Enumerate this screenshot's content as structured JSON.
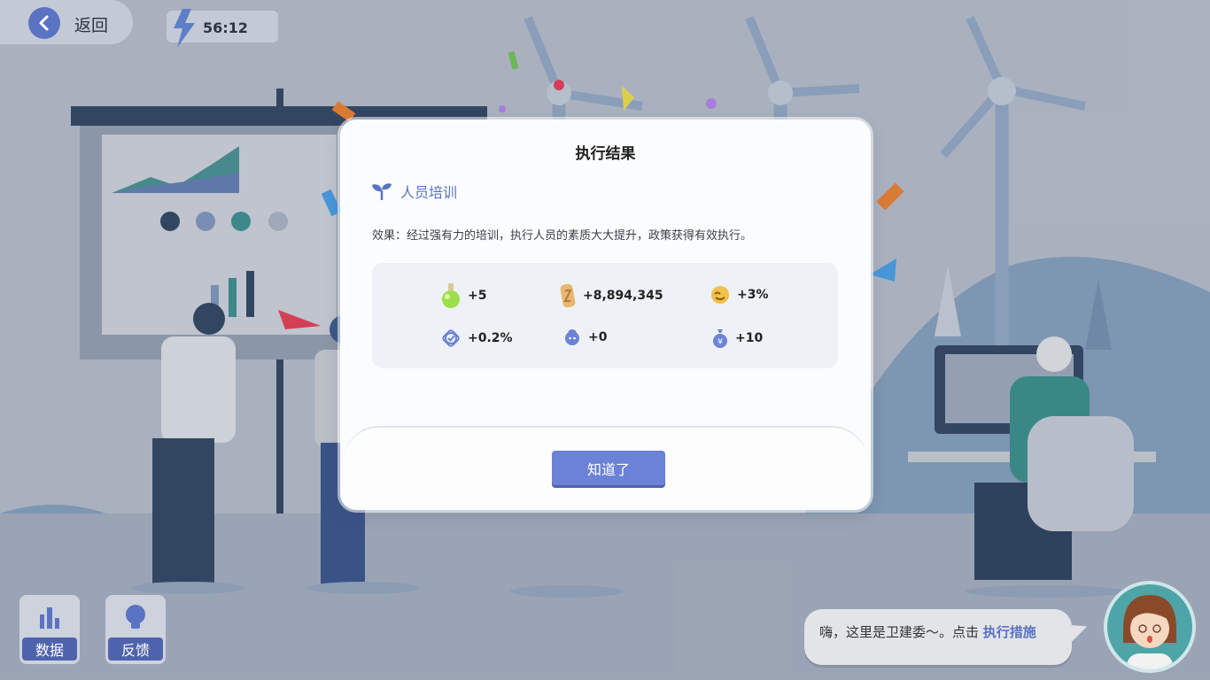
{
  "header": {
    "back_label": "返回",
    "timer": "56:12"
  },
  "result_dialog": {
    "title": "执行结果",
    "measure_name": "人员培训",
    "effect_text": "效果：经过强有力的培训，执行人员的素质大大提升，政策获得有效执行。",
    "stats": [
      {
        "icon": "potion-icon",
        "value": "+5"
      },
      {
        "icon": "gold-money-icon",
        "value": "+8,894,345"
      },
      {
        "icon": "satisfaction-face-icon",
        "value": "+3%"
      },
      {
        "icon": "check-badge-icon",
        "value": "+0.2%"
      },
      {
        "icon": "person-head-icon",
        "value": "+0"
      },
      {
        "icon": "money-bag-icon",
        "value": "+10"
      }
    ],
    "ok_label": "知道了"
  },
  "side_buttons": {
    "data_label": "数据",
    "feedback_label": "反馈"
  },
  "assistant": {
    "message": "嗨，这里是卫建委～。点击 ",
    "link_text": "执行措施"
  },
  "colors": {
    "accent": "#5a73c2",
    "button": "#6b82d6",
    "dark_button": "#4f63ad",
    "panel": "#eef1f6"
  }
}
